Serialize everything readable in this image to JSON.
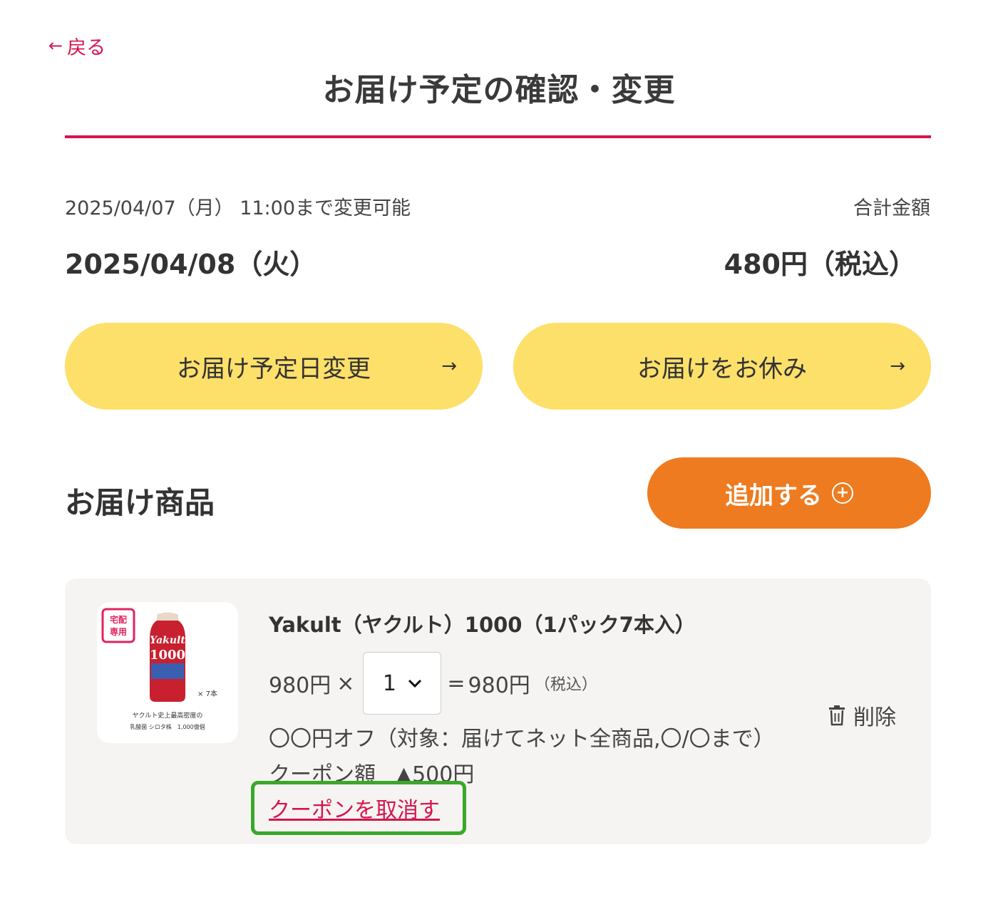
{
  "header": {
    "back_arrow": "←",
    "back_label": "戻る",
    "title": "お届け予定の確認・変更"
  },
  "summary": {
    "deadline": "2025/04/07（月） 11:00まで変更可能",
    "total_label": "合計金額",
    "delivery_date": "2025/04/08（火）",
    "total_amount": "480円（税込）"
  },
  "actions": {
    "change_date_label": "お届け予定日変更",
    "skip_label": "お届けをお休み",
    "arrow": "→"
  },
  "items_section": {
    "title": "お届け商品",
    "add_label": "追加する",
    "add_icon": "⊕"
  },
  "product": {
    "badge_line1": "宅配",
    "badge_line2": "専用",
    "bottle_brand": "Yakult",
    "bottle_number": "1000",
    "pack_note": "× 7本",
    "tagline_1": "ヤクルト史上最高密度の",
    "tagline_2": "乳酸菌 シロタ株　1,000億個",
    "name": "Yakult（ヤクルト）1000（1パック7本入）",
    "unit_price": "980円",
    "times": "×",
    "quantity": "1",
    "equals": "=",
    "line_total": "980円",
    "tax_note": "（税込）",
    "delete_label": "削除",
    "coupon_description": "〇〇円オフ（対象：届けてネット全商品,〇/〇まで）",
    "coupon_amount_label": "クーポン額",
    "coupon_amount_value": "▲500円",
    "cancel_coupon_label": "クーポンを取消す"
  },
  "colors": {
    "accent_red": "#d6144f",
    "yellow_button": "#fde06a",
    "orange_button": "#ee7b20",
    "card_bg": "#f5f4f2",
    "highlight_green": "#3aa829"
  }
}
